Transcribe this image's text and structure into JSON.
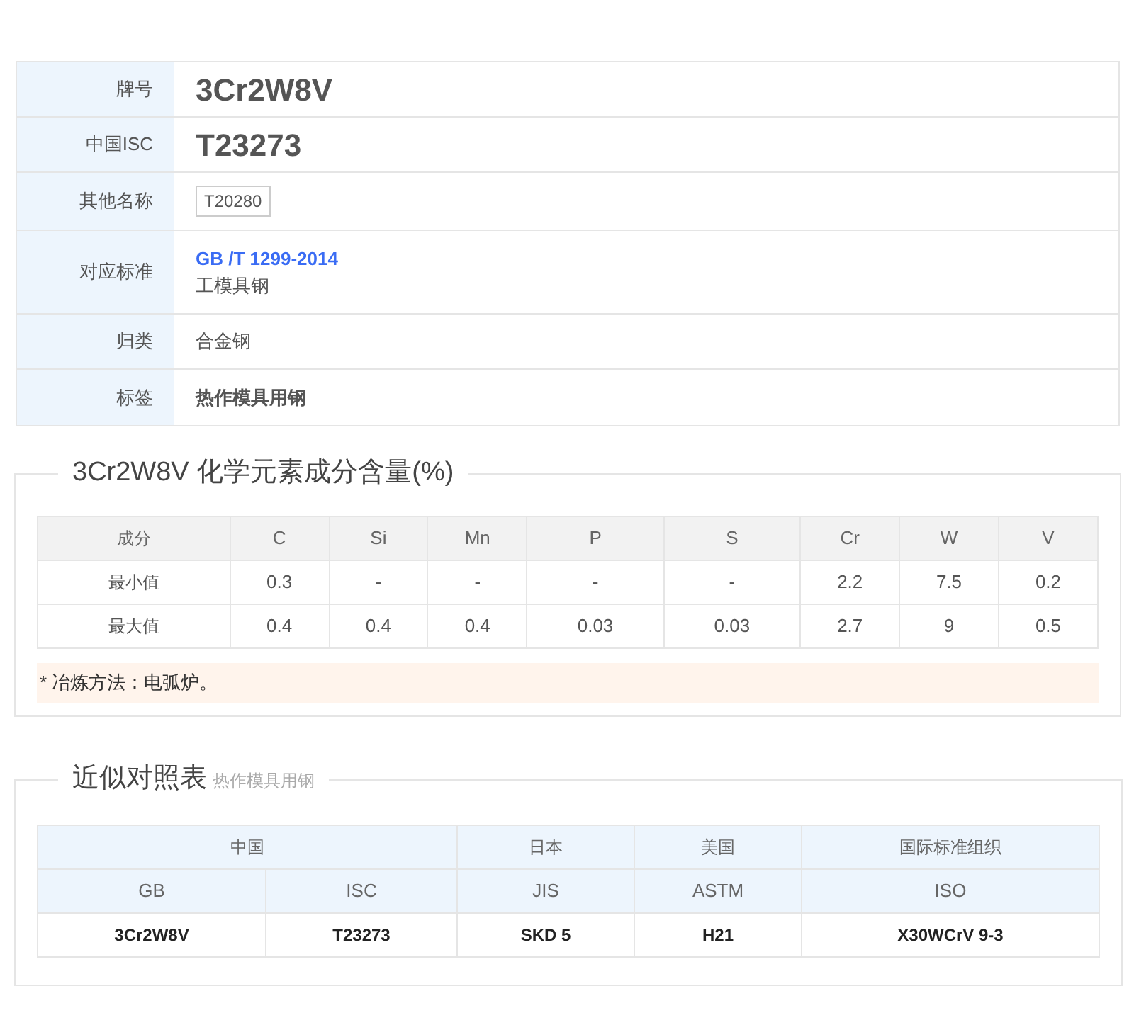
{
  "info_rows": [
    {
      "label": "牌号",
      "kind": "title",
      "value": "3Cr2W8V"
    },
    {
      "label": "中国ISC",
      "kind": "title",
      "value": "T23273"
    },
    {
      "label": "其他名称",
      "kind": "tags",
      "tags": [
        "T20280"
      ]
    },
    {
      "label": "对应标准",
      "kind": "standard",
      "link": "GB /T 1299-2014",
      "value": "工模具钢"
    },
    {
      "label": "归类",
      "kind": "plain",
      "value": "合金钢"
    },
    {
      "label": "标签",
      "kind": "bold",
      "value": "热作模具用钢"
    }
  ],
  "composition": {
    "title": "3Cr2W8V 化学元素成分含量(%)",
    "columns": [
      "成分",
      "C",
      "Si",
      "Mn",
      "P",
      "S",
      "Cr",
      "W",
      "V"
    ],
    "rows": [
      [
        "最小值",
        "0.3",
        "-",
        "-",
        "-",
        "-",
        "2.2",
        "7.5",
        "0.2"
      ],
      [
        "最大值",
        "0.4",
        "0.4",
        "0.4",
        "0.03",
        "0.03",
        "2.7",
        "9",
        "0.5"
      ]
    ],
    "note": "* 冶炼方法：电弧炉。"
  },
  "comparison": {
    "title": "近似对照表",
    "subtitle": "热作模具用钢",
    "groups": [
      {
        "label": "中国",
        "columns": [
          "GB",
          "ISC"
        ]
      },
      {
        "label": "日本",
        "columns": [
          "JIS"
        ]
      },
      {
        "label": "美国",
        "columns": [
          "ASTM"
        ]
      },
      {
        "label": "国际标准组织",
        "columns": [
          "ISO"
        ]
      }
    ],
    "row": [
      "3Cr2W8V",
      "T23273",
      "SKD 5",
      "H21",
      "X30WCrV 9-3"
    ]
  }
}
